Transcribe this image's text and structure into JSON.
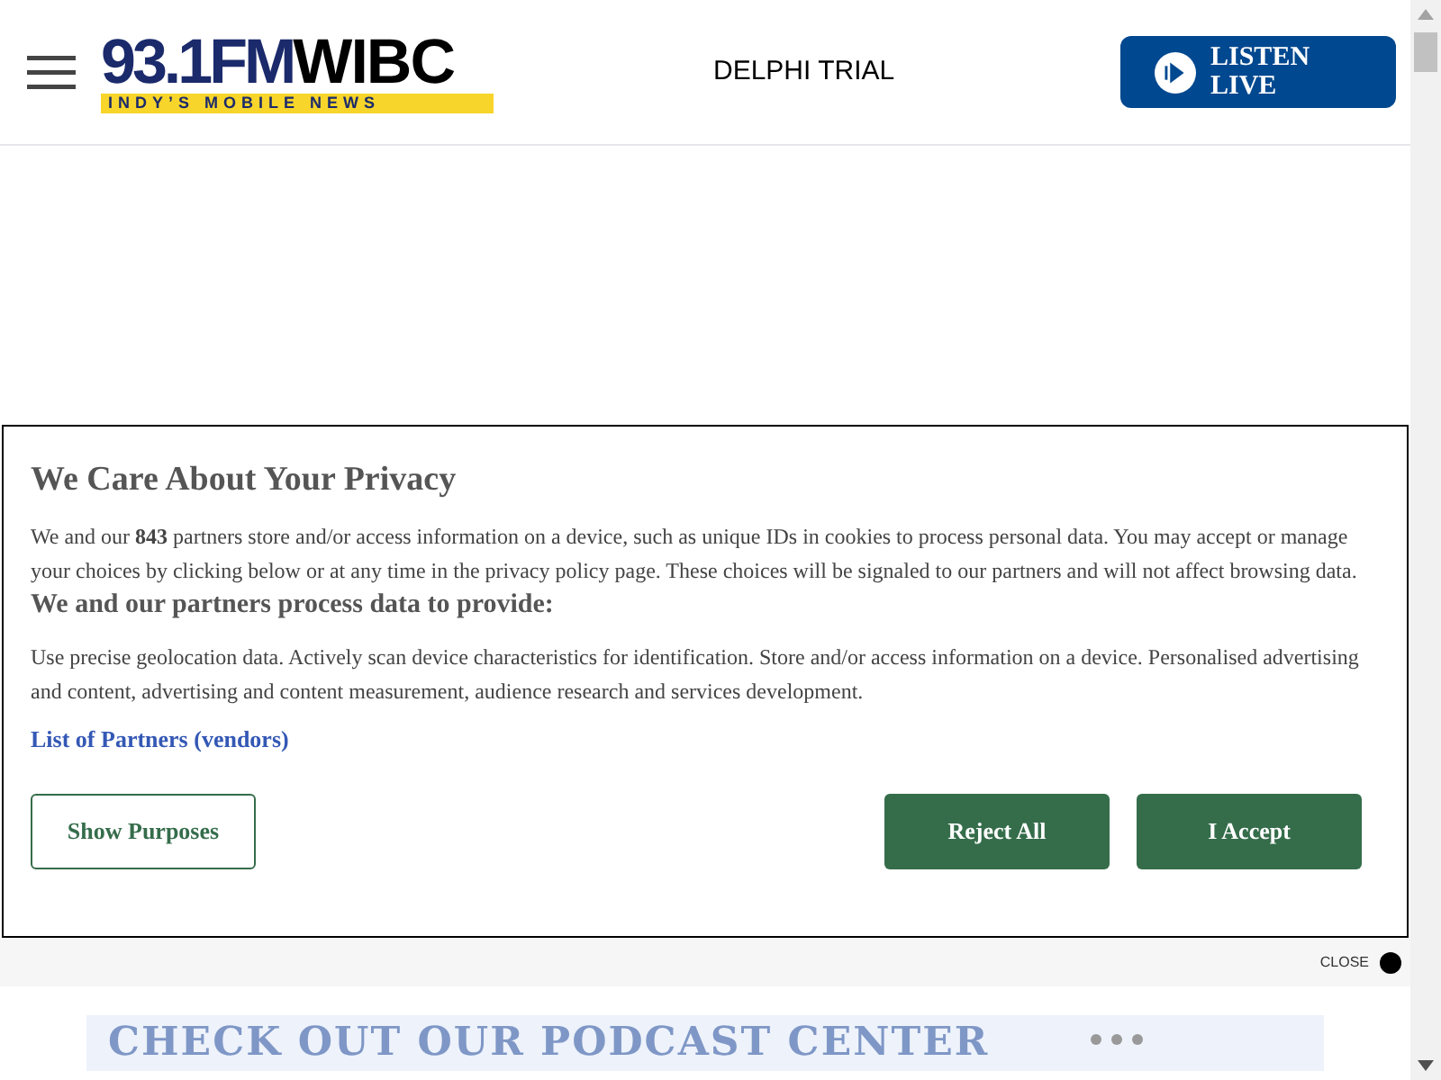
{
  "header": {
    "logo": {
      "main": "93.1FM",
      "brand": "WIBC",
      "tagline": "INDY’S MOBILE NEWS"
    },
    "nav_link": "DELPHI TRIAL",
    "listen_button": {
      "line_1": "LISTEN",
      "line_2": "LIVE"
    }
  },
  "consent": {
    "title": "We Care About Your Privacy",
    "intro": "We and our **843** partners store and/or access information on a device, such as unique IDs in cookies to process personal data. You may accept or manage your choices by clicking below or at any time in the privacy policy page. These choices will be signaled to our partners and will not affect browsing data.",
    "subtitle": "We and our partners process data to provide:",
    "purposes": "Use precise geolocation data. Actively scan device characteristics for identification. Store and/or access information on a device. Personalised advertising and content, advertising and content measurement, audience research and services development.",
    "partners_link": "List of Partners (vendors)",
    "buttons": [
      {
        "label": "Show Purposes",
        "kind": "outline"
      },
      {
        "label": "Reject All",
        "kind": "filled"
      },
      {
        "label": "I Accept",
        "kind": "filled"
      }
    ]
  },
  "ad": {
    "close_label": "CLOSE",
    "banner_text": "CHECK OUT OUR PODCAST CENTER"
  }
}
